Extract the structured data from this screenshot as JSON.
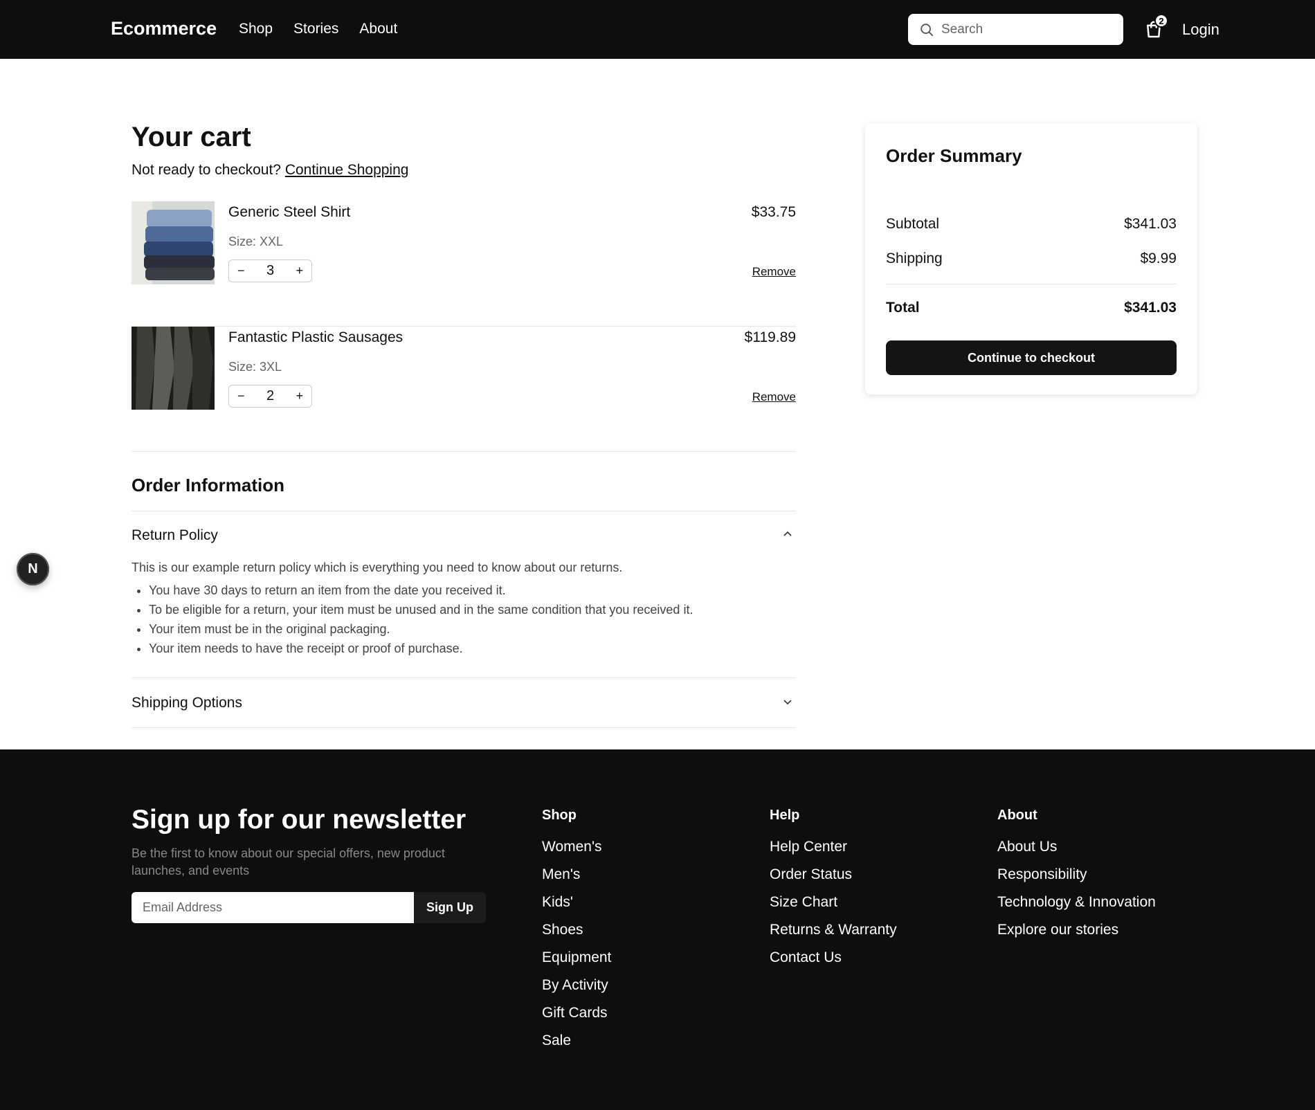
{
  "header": {
    "brand": "Ecommerce",
    "nav": [
      "Shop",
      "Stories",
      "About"
    ],
    "search_placeholder": "Search",
    "cart_count": "2",
    "login": "Login"
  },
  "cart": {
    "title": "Your cart",
    "subtitle": "Not ready to checkout?",
    "continue_link": "Continue Shopping",
    "items": [
      {
        "name": "Generic Steel Shirt",
        "size": "Size: XXL",
        "qty": "3",
        "price": "$33.75",
        "remove": "Remove",
        "minus": "−",
        "plus": "+"
      },
      {
        "name": "Fantastic Plastic Sausages",
        "size": "Size: 3XL",
        "qty": "2",
        "price": "$119.89",
        "remove": "Remove",
        "minus": "−",
        "plus": "+"
      }
    ]
  },
  "order_info": {
    "title": "Order Information",
    "return_policy": {
      "title": "Return Policy",
      "intro": "This is our example return policy which is everything you need to know about our returns.",
      "points": [
        "You have 30 days to return an item from the date you received it.",
        "To be eligible for a return, your item must be unused and in the same condition that you received it.",
        "Your item must be in the original packaging.",
        "Your item needs to have the receipt or proof of purchase."
      ]
    },
    "shipping_title": "Shipping Options"
  },
  "summary": {
    "title": "Order Summary",
    "subtotal_label": "Subtotal",
    "subtotal": "$341.03",
    "shipping_label": "Shipping",
    "shipping": "$9.99",
    "total_label": "Total",
    "total": "$341.03",
    "checkout": "Continue to checkout"
  },
  "floating_badge": "N",
  "footer": {
    "newsletter_title": "Sign up for our newsletter",
    "newsletter_sub": "Be the first to know about our special offers, new product launches, and events",
    "email_placeholder": "Email Address",
    "signup": "Sign Up",
    "shop": {
      "title": "Shop",
      "links": [
        "Women's",
        "Men's",
        "Kids'",
        "Shoes",
        "Equipment",
        "By Activity",
        "Gift Cards",
        "Sale"
      ]
    },
    "help": {
      "title": "Help",
      "links": [
        "Help Center",
        "Order Status",
        "Size Chart",
        "Returns & Warranty",
        "Contact Us"
      ]
    },
    "about": {
      "title": "About",
      "links": [
        "About Us",
        "Responsibility",
        "Technology & Innovation",
        "Explore our stories"
      ]
    }
  },
  "icons": {
    "search": "search-icon",
    "cart": "shopping-bag-icon",
    "return_chevron": "chevron-up-icon",
    "shipping_chevron": "chevron-down-icon"
  }
}
